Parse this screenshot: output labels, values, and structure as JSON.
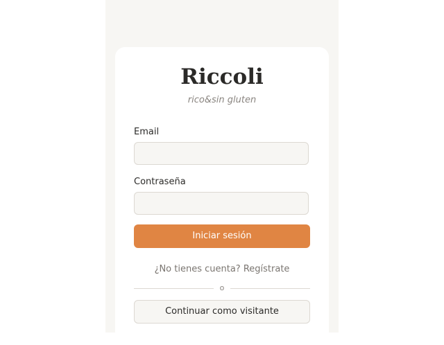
{
  "brand": {
    "title": "Riccoli",
    "tagline": "rico&sin gluten"
  },
  "form": {
    "email_label": "Email",
    "email_value": "",
    "password_label": "Contraseña",
    "password_value": "",
    "submit_label": "Iniciar sesión"
  },
  "register_link": "¿No tienes cuenta? Regístrate",
  "divider_text": "o",
  "guest_button_label": "Continuar como visitante",
  "colors": {
    "accent": "#e08543",
    "page_background": "#f7f6f3",
    "card_background": "#ffffff",
    "text": "#2b2a28"
  }
}
